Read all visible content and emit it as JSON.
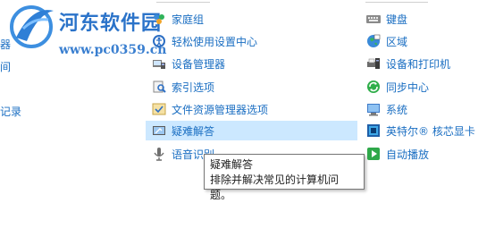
{
  "watermark": {
    "site_name": "河东软件园",
    "url": "www.pc0359.cn"
  },
  "left_column": {
    "items": [
      {
        "label": "器"
      },
      {
        "label": "间"
      },
      {
        "label": "记录"
      }
    ]
  },
  "middle_column": {
    "items": [
      {
        "label": "家庭组",
        "icon": "homegroup-icon"
      },
      {
        "label": "轻松使用设置中心",
        "icon": "ease-of-access-icon"
      },
      {
        "label": "设备管理器",
        "icon": "device-manager-icon"
      },
      {
        "label": "索引选项",
        "icon": "indexing-options-icon"
      },
      {
        "label": "文件资源管理器选项",
        "icon": "file-explorer-options-icon"
      },
      {
        "label": "疑难解答",
        "icon": "troubleshooting-icon",
        "highlighted": true
      },
      {
        "label": "语音识别",
        "icon": "speech-recognition-icon"
      }
    ]
  },
  "right_column": {
    "items": [
      {
        "label": "键盘",
        "icon": "keyboard-icon"
      },
      {
        "label": "区域",
        "icon": "region-icon"
      },
      {
        "label": "设备和打印机",
        "icon": "devices-printers-icon"
      },
      {
        "label": "同步中心",
        "icon": "sync-center-icon"
      },
      {
        "label": "系统",
        "icon": "system-icon"
      },
      {
        "label": "英特尔® 核芯显卡",
        "icon": "intel-graphics-icon"
      },
      {
        "label": "自动播放",
        "icon": "autoplay-icon"
      }
    ]
  },
  "tooltip": {
    "title": "疑难解答",
    "description": "排除并解决常见的计算机问题。"
  },
  "colors": {
    "link": "#1a6ec2",
    "highlight": "#cce8ff"
  }
}
